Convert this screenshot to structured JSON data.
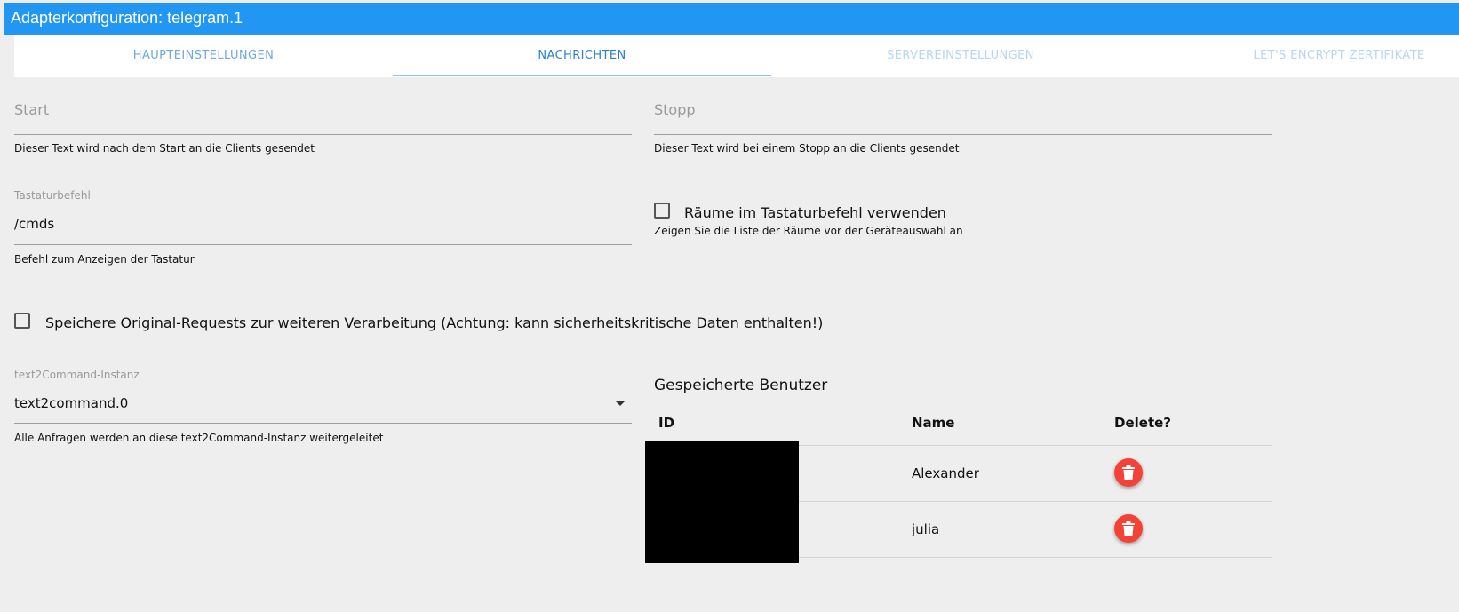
{
  "window": {
    "title": "Adapterkonfiguration: telegram.1"
  },
  "tabs": [
    {
      "label": "HAUPTEINSTELLUNGEN",
      "state": "normal"
    },
    {
      "label": "NACHRICHTEN",
      "state": "active"
    },
    {
      "label": "SERVEREINSTELLUNGEN",
      "state": "disabled"
    },
    {
      "label": "LET'S ENCRYPT ZERTIFIKATE",
      "state": "disabled"
    }
  ],
  "fields": {
    "start": {
      "label": "Start",
      "value": "",
      "helper": "Dieser Text wird nach dem Start an die Clients gesendet"
    },
    "stopp": {
      "label": "Stopp",
      "value": "",
      "helper": "Dieser Text wird bei einem Stopp an die Clients gesendet"
    },
    "keyboard": {
      "label": "Tastaturbefehl",
      "value": "/cmds",
      "helper": "Befehl zum Anzeigen der Tastatur"
    },
    "rooms": {
      "label": "Räume im Tastaturbefehl verwenden",
      "checked": false,
      "helper": "Zeigen Sie die Liste der Räume vor der Geräteauswahl an"
    },
    "save_raw": {
      "label": "Speichere Original-Requests zur weiteren Verarbeitung (Achtung: kann sicherheitskritische Daten enthalten!)",
      "checked": false
    },
    "text2command": {
      "label": "text2Command-Instanz",
      "value": "text2command.0",
      "helper": "Alle Anfragen werden an diese text2Command-Instanz weitergeleitet"
    }
  },
  "users": {
    "title": "Gespeicherte Benutzer",
    "headers": {
      "id": "ID",
      "name": "Name",
      "delete": "Delete?"
    },
    "rows": [
      {
        "id": "",
        "name": "Alexander"
      },
      {
        "id": "",
        "name": "julia"
      }
    ]
  },
  "colors": {
    "accent": "#2196f3",
    "delete": "#f44336",
    "background": "#eeeeee"
  },
  "icons": {
    "delete": "trash-icon",
    "dropdown": "caret-down-icon"
  }
}
